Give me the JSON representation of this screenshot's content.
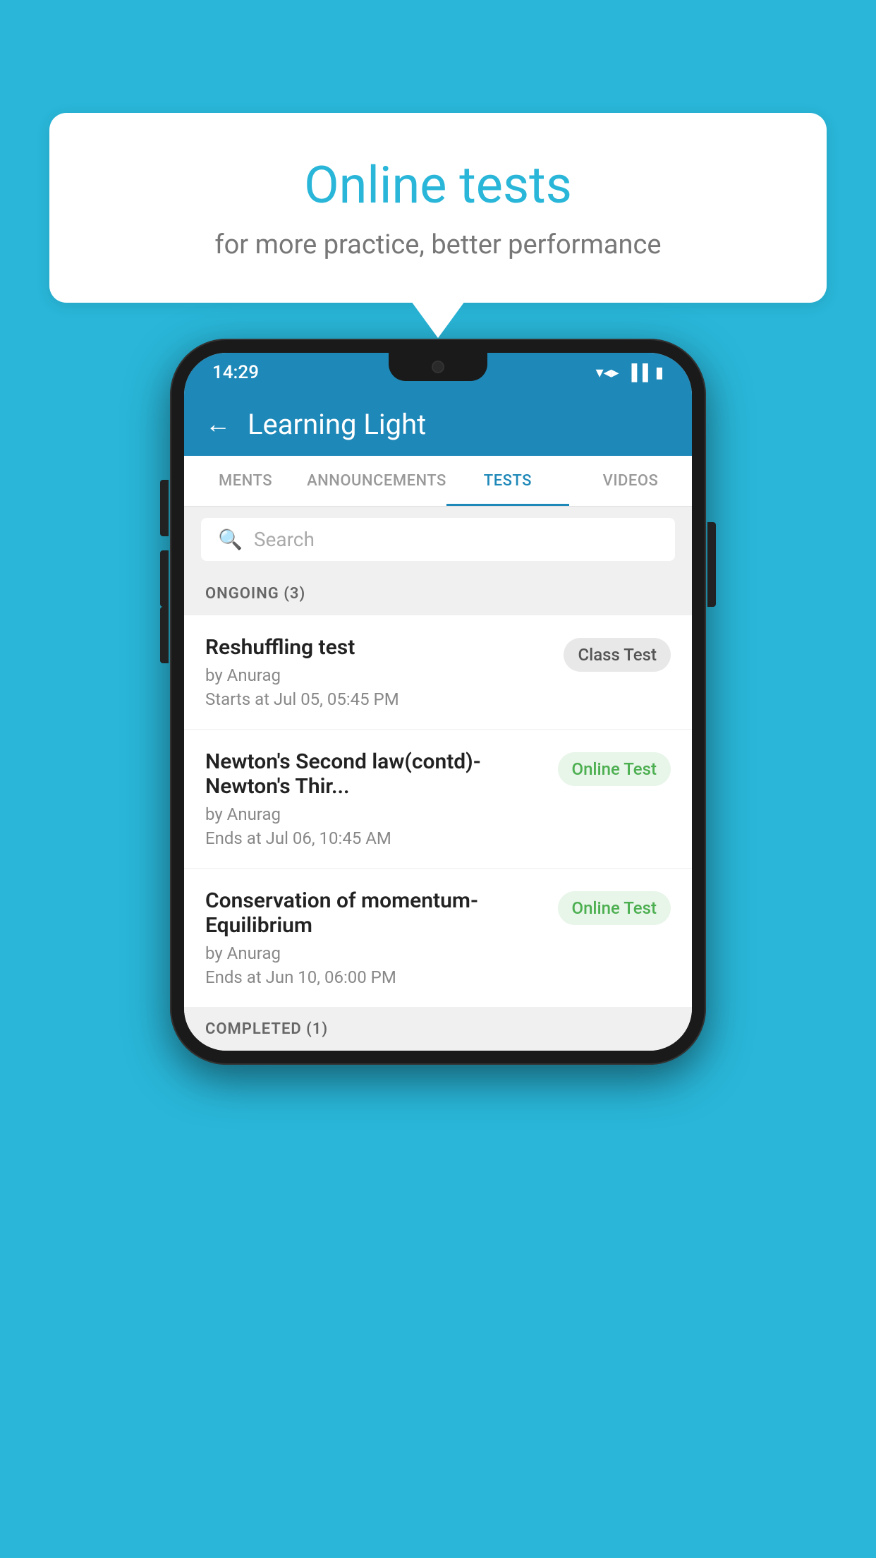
{
  "background": {
    "color": "#29b6d8"
  },
  "speech_bubble": {
    "title": "Online tests",
    "subtitle": "for more practice, better performance"
  },
  "phone": {
    "status_bar": {
      "time": "14:29",
      "icons": [
        "wifi",
        "signal",
        "battery"
      ]
    },
    "header": {
      "back_label": "←",
      "title": "Learning Light"
    },
    "tabs": [
      {
        "label": "MENTS",
        "active": false
      },
      {
        "label": "ANNOUNCEMENTS",
        "active": false
      },
      {
        "label": "TESTS",
        "active": true
      },
      {
        "label": "VIDEOS",
        "active": false
      }
    ],
    "search": {
      "placeholder": "Search"
    },
    "sections": [
      {
        "title": "ONGOING (3)",
        "tests": [
          {
            "name": "Reshuffling test",
            "author": "by Anurag",
            "time_label": "Starts at  Jul 05, 05:45 PM",
            "badge": "Class Test",
            "badge_type": "class"
          },
          {
            "name": "Newton's Second law(contd)-Newton's Thir...",
            "author": "by Anurag",
            "time_label": "Ends at  Jul 06, 10:45 AM",
            "badge": "Online Test",
            "badge_type": "online"
          },
          {
            "name": "Conservation of momentum-Equilibrium",
            "author": "by Anurag",
            "time_label": "Ends at  Jun 10, 06:00 PM",
            "badge": "Online Test",
            "badge_type": "online"
          }
        ]
      }
    ],
    "completed_section": {
      "title": "COMPLETED (1)"
    }
  }
}
